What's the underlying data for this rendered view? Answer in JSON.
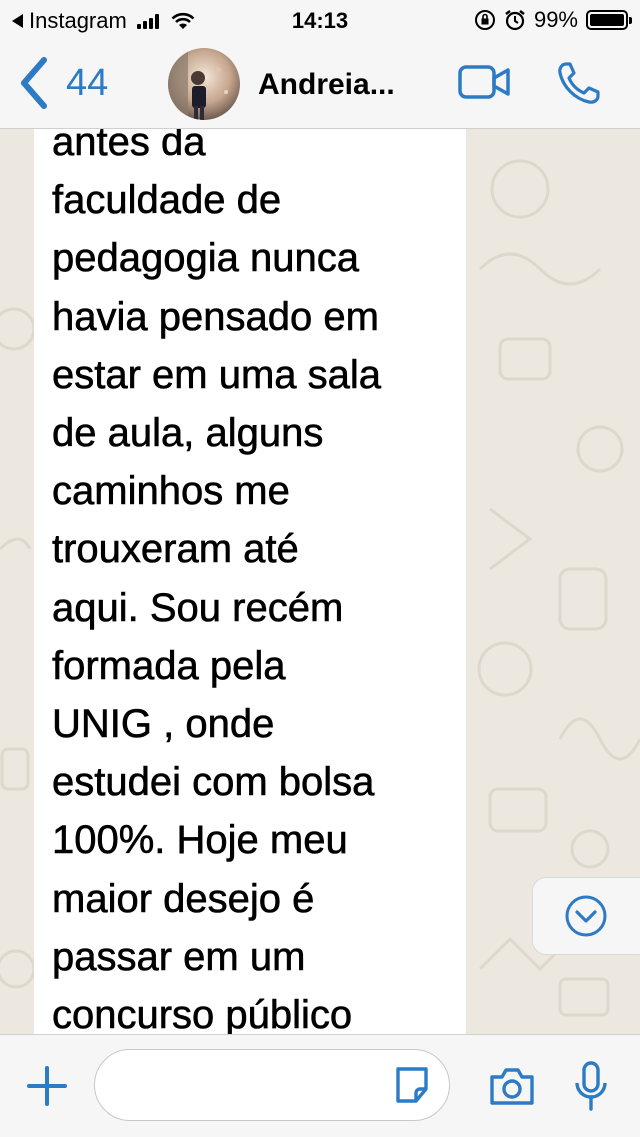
{
  "status_bar": {
    "back_app": "Instagram",
    "time": "14:13",
    "battery_percent": "99%",
    "battery_level": 0.99,
    "icons": [
      "back-triangle-icon",
      "signal-icon",
      "wifi-icon",
      "orientation-lock-icon",
      "alarm-icon",
      "battery-icon"
    ]
  },
  "nav": {
    "back_count": "44",
    "contact_name": "Andreia...",
    "icons": [
      "chevron-left-icon",
      "video-call-icon",
      "phone-icon"
    ]
  },
  "message": {
    "text": "antes da\nfaculdade de\npedagogia nunca\nhavia pensado em\nestar em uma sala\nde aula, alguns\ncaminhos me\ntrouxeram até\naqui. Sou recém\nformada pela\nUNIG , onde\nestudei com bolsa\n100%. Hoje meu\nmaior desejo é\npassar em um\nconcurso público"
  },
  "composer": {
    "placeholder": "",
    "icons": [
      "plus-icon",
      "sticker-icon",
      "camera-icon",
      "microphone-icon"
    ]
  },
  "colors": {
    "accent": "#2c7bc4",
    "chat_background": "#ece8df",
    "bubble": "#ffffff",
    "bar_background": "#f6f6f6"
  }
}
